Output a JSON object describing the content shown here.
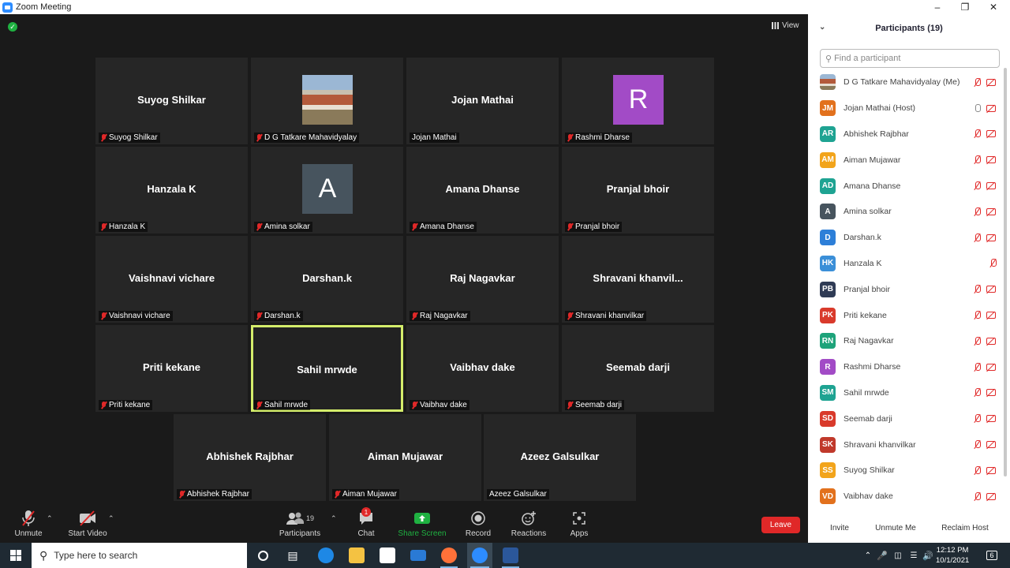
{
  "window": {
    "title": "Zoom Meeting"
  },
  "meeting": {
    "view_label": "View",
    "tiles": [
      {
        "name": "Suyog Shilkar",
        "label": "Suyog Shilkar",
        "muted": true,
        "media": "none"
      },
      {
        "name": "",
        "label": "D G Tatkare Mahavidyalay",
        "muted": true,
        "media": "photo"
      },
      {
        "name": "Jojan Mathai",
        "label": "Jojan Mathai",
        "muted": false,
        "media": "none"
      },
      {
        "name": "",
        "label": "Rashmi Dharse",
        "muted": true,
        "media": "letter",
        "letter": "R",
        "color": "#a24bc6"
      },
      {
        "name": "Hanzala K",
        "label": "Hanzala K",
        "muted": true,
        "media": "none"
      },
      {
        "name": "",
        "label": "Amina solkar",
        "muted": true,
        "media": "letter",
        "letter": "A",
        "color": "#47545e"
      },
      {
        "name": "Amana Dhanse",
        "label": "Amana Dhanse",
        "muted": true,
        "media": "none"
      },
      {
        "name": "Pranjal bhoir",
        "label": "Pranjal bhoir",
        "muted": true,
        "media": "none"
      },
      {
        "name": "Vaishnavi  vichare",
        "label": "Vaishnavi  vichare",
        "muted": true,
        "media": "none"
      },
      {
        "name": "Darshan.k",
        "label": "Darshan.k",
        "muted": true,
        "media": "none"
      },
      {
        "name": "Raj Nagavkar",
        "label": "Raj Nagavkar",
        "muted": true,
        "media": "none"
      },
      {
        "name": "Shravani  khanvil...",
        "label": "Shravani khanvilkar",
        "muted": true,
        "media": "none"
      },
      {
        "name": "Priti kekane",
        "label": "Priti kekane",
        "muted": true,
        "media": "none"
      },
      {
        "name": "Sahil mrwde",
        "label": "Sahil mrwde",
        "muted": true,
        "media": "none",
        "active": true
      },
      {
        "name": "Vaibhav dake",
        "label": "Vaibhav dake",
        "muted": true,
        "media": "none"
      },
      {
        "name": "Seemab darji",
        "label": "Seemab darji",
        "muted": true,
        "media": "none"
      },
      {
        "name": "Abhishek Rajbhar",
        "label": "Abhishek Rajbhar",
        "muted": true,
        "media": "none"
      },
      {
        "name": "Aiman Mujawar",
        "label": "Aiman Mujawar",
        "muted": true,
        "media": "none"
      },
      {
        "name": "Azeez Galsulkar",
        "label": "Azeez Galsulkar",
        "muted": false,
        "media": "none"
      }
    ]
  },
  "toolbar": {
    "unmute": "Unmute",
    "start_video": "Start Video",
    "participants": "Participants",
    "participants_count": "19",
    "chat": "Chat",
    "chat_badge": "1",
    "share_screen": "Share Screen",
    "record": "Record",
    "reactions": "Reactions",
    "apps": "Apps",
    "leave": "Leave"
  },
  "panel": {
    "title": "Participants (19)",
    "search_placeholder": "Find a participant",
    "participants": [
      {
        "initials": "",
        "name": "D G Tatkare Mahavidyalay (Me)",
        "color": "#8a6a4a",
        "mic": "off",
        "cam": true
      },
      {
        "initials": "JM",
        "name": "Jojan Mathai (Host)",
        "color": "#e2711d",
        "mic": "on",
        "cam": true
      },
      {
        "initials": "AR",
        "name": "Abhishek Rajbhar",
        "color": "#1ea392",
        "mic": "off",
        "cam": true
      },
      {
        "initials": "AM",
        "name": "Aiman Mujawar",
        "color": "#f2a41b",
        "mic": "off",
        "cam": true
      },
      {
        "initials": "AD",
        "name": "Amana Dhanse",
        "color": "#1ea392",
        "mic": "off",
        "cam": true
      },
      {
        "initials": "A",
        "name": "Amina solkar",
        "color": "#47545e",
        "mic": "off",
        "cam": true
      },
      {
        "initials": "D",
        "name": "Darshan.k",
        "color": "#2d7fd8",
        "mic": "off",
        "cam": true
      },
      {
        "initials": "HK",
        "name": "Hanzala K",
        "color": "#3b8fd8",
        "mic": "off",
        "cam": false
      },
      {
        "initials": "PB",
        "name": "Pranjal bhoir",
        "color": "#2f3b55",
        "mic": "off",
        "cam": true
      },
      {
        "initials": "PK",
        "name": "Priti kekane",
        "color": "#d93a2b",
        "mic": "off",
        "cam": true
      },
      {
        "initials": "RN",
        "name": "Raj Nagavkar",
        "color": "#1ea37a",
        "mic": "off",
        "cam": true
      },
      {
        "initials": "R",
        "name": "Rashmi Dharse",
        "color": "#a24bc6",
        "mic": "off",
        "cam": true
      },
      {
        "initials": "SM",
        "name": "Sahil mrwde",
        "color": "#1ea392",
        "mic": "off",
        "cam": true
      },
      {
        "initials": "SD",
        "name": "Seemab darji",
        "color": "#d93a2b",
        "mic": "off",
        "cam": true
      },
      {
        "initials": "SK",
        "name": "Shravani khanvilkar",
        "color": "#c0392b",
        "mic": "off",
        "cam": true
      },
      {
        "initials": "SS",
        "name": "Suyog Shilkar",
        "color": "#f2a41b",
        "mic": "off",
        "cam": true
      },
      {
        "initials": "VD",
        "name": "Vaibhav dake",
        "color": "#e2711d",
        "mic": "off",
        "cam": true
      }
    ],
    "invite": "Invite",
    "unmute_me": "Unmute Me",
    "reclaim_host": "Reclaim Host"
  },
  "taskbar": {
    "search_placeholder": "Type here to search",
    "time": "12:12 PM",
    "date": "10/1/2021",
    "notification_count": "6"
  }
}
